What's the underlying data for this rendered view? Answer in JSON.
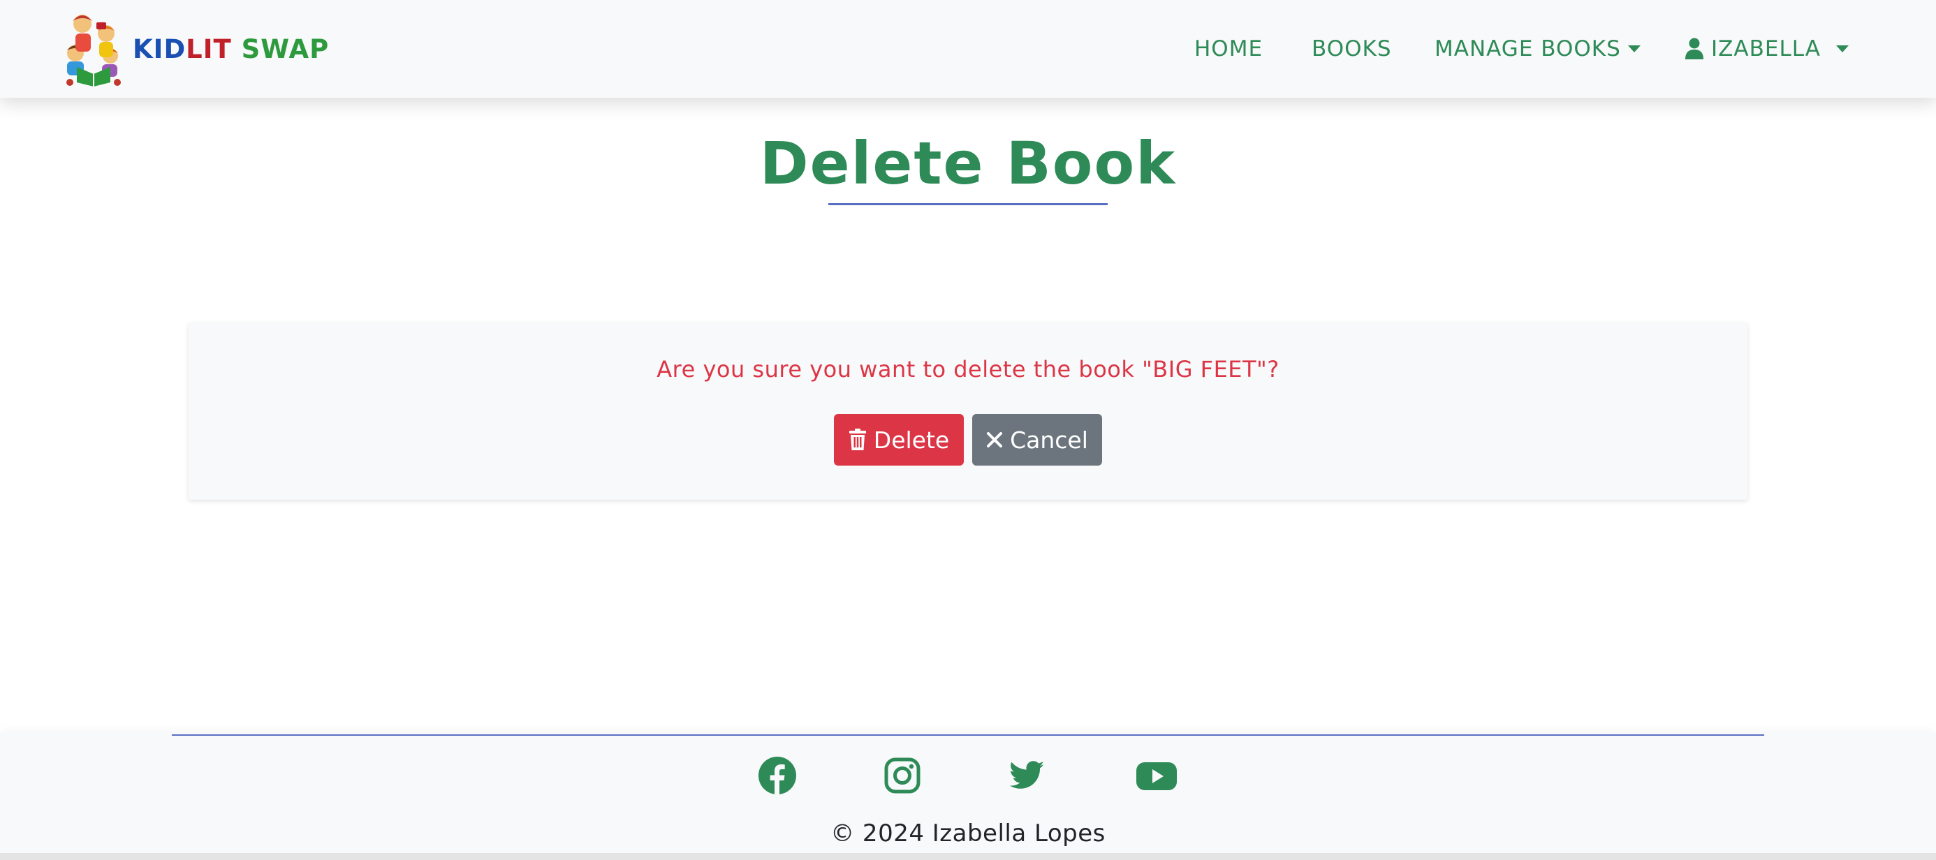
{
  "navbar": {
    "brand": {
      "part1": "KID",
      "part2": "LIT",
      "part3": "SWAP"
    },
    "links": {
      "home": "HOME",
      "books": "BOOKS",
      "manage_books": "MANAGE BOOKS",
      "user": "IZABELLA"
    }
  },
  "page": {
    "title": "Delete Book"
  },
  "confirm": {
    "message": "Are you sure you want to delete the book \"BIG FEET\"?",
    "delete_label": "Delete",
    "cancel_label": "Cancel"
  },
  "footer": {
    "social": [
      "facebook-icon",
      "instagram-icon",
      "twitter-icon",
      "youtube-icon"
    ],
    "copyright": "© 2024 Izabella Lopes"
  },
  "colors": {
    "brand_green": "#2e8b57",
    "danger": "#dc3545",
    "secondary": "#6c757d",
    "accent_rule": "#5a6fc4",
    "navbar_bg": "#f8f9fa"
  }
}
